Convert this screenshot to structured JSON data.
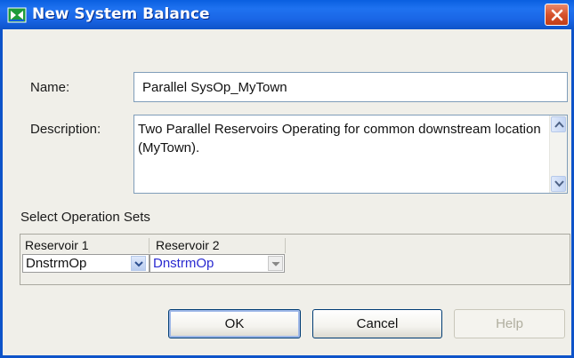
{
  "window": {
    "title": "New System Balance"
  },
  "form": {
    "name_label": "Name:",
    "name_value": "Parallel SysOp_MyTown",
    "description_label": "Description:",
    "description_value": "Two Parallel Reservoirs Operating for common downstream location (MyTown)."
  },
  "operation_sets": {
    "section_label": "Select Operation Sets",
    "columns": [
      "Reservoir 1",
      "Reservoir 2"
    ],
    "values": [
      "DnstrmOp",
      "DnstrmOp"
    ]
  },
  "buttons": {
    "ok": "OK",
    "cancel": "Cancel",
    "help": "Help"
  },
  "colors": {
    "title_bar": "#1f72f0",
    "dialog_bg": "#f0efe9",
    "close_button": "#d6522c",
    "link_text": "#2a2ad0"
  },
  "icons": {
    "app": "system-balance-icon",
    "close": "close-icon"
  }
}
